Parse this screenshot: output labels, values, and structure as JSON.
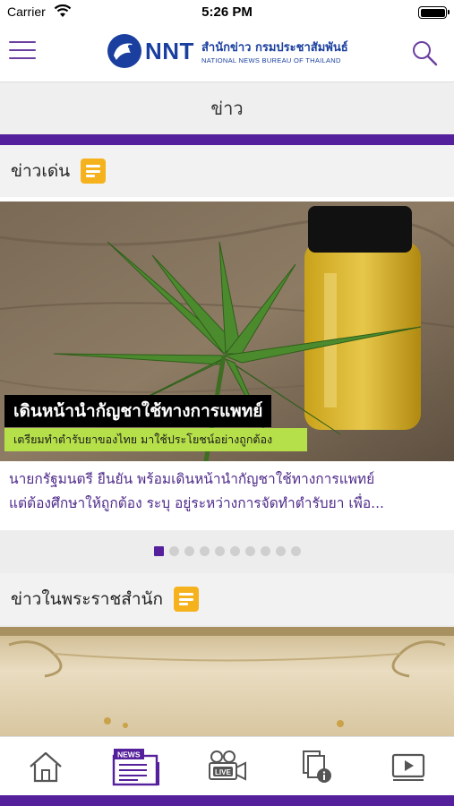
{
  "status_bar": {
    "carrier": "Carrier",
    "time": "5:26 PM"
  },
  "header": {
    "logo_brand": "NNT",
    "logo_thai": "สำนักข่าว กรมประชาสัมพันธ์",
    "logo_english": "NATIONAL NEWS BUREAU OF THAILAND",
    "menu_icon": "hamburger-icon",
    "search_icon": "search-icon"
  },
  "page": {
    "title": "ข่าว"
  },
  "sections": [
    {
      "label": "ข่าวเด่น",
      "icon": "document-icon"
    },
    {
      "label": "ข่าวในพระราชสำนัก",
      "icon": "document-icon"
    }
  ],
  "headline": {
    "overlay_title": "เดินหน้านำกัญชาใช้ทางการแพทย์",
    "overlay_subtitle": "เตรียมทำตำรับยาของไทย มาใช้ประโยชน์อย่างถูกต้อง",
    "summary_line1": "นายกรัฐมนตรี ยืนยัน พร้อมเดินหน้านำกัญชาใช้ทางการแพทย์",
    "summary_line2": "แต่ต้องศึกษาให้ถูกต้อง ระบุ อยู่ระหว่างการจัดทำตำรับยา เพื่อ..."
  },
  "carousel": {
    "total": 10,
    "active_index": 0
  },
  "tab_bar": {
    "items": [
      {
        "icon": "home-icon",
        "selected": false
      },
      {
        "icon": "news-icon",
        "label": "NEWS",
        "selected": true
      },
      {
        "icon": "live-camera-icon",
        "label": "LIVE",
        "selected": false
      },
      {
        "icon": "documents-info-icon",
        "selected": false
      },
      {
        "icon": "video-play-icon",
        "selected": false
      }
    ]
  },
  "colors": {
    "accent_purple": "#55209b",
    "icon_yellow": "#f5b21c",
    "brand_blue": "#1a3f9f",
    "headline_text": "#4e2a8a"
  }
}
